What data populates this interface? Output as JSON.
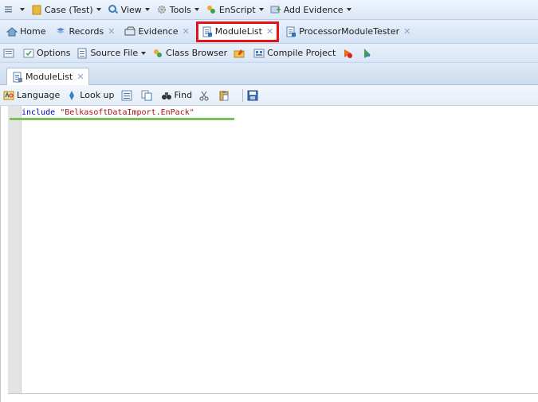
{
  "menu_bar": {
    "items": [
      {
        "label": "Case (Test)",
        "icon": "case-folder-icon"
      },
      {
        "label": "View",
        "icon": "view-icon"
      },
      {
        "label": "Tools",
        "icon": "tools-gear-icon"
      },
      {
        "label": "EnScript",
        "icon": "enscript-icon"
      },
      {
        "label": "Add Evidence",
        "icon": "add-evidence-icon"
      }
    ]
  },
  "tabs": [
    {
      "label": "Home",
      "icon": "home-icon"
    },
    {
      "label": "Records",
      "icon": "records-icon"
    },
    {
      "label": "Evidence",
      "icon": "evidence-icon"
    },
    {
      "label": "ModuleList",
      "icon": "script-file-icon",
      "highlighted": true
    },
    {
      "label": "ProcessorModuleTester",
      "icon": "script-file-icon"
    }
  ],
  "toolbar": {
    "options_label": "Options",
    "source_file_label": "Source File",
    "class_browser_label": "Class Browser",
    "compile_project_label": "Compile Project"
  },
  "document_tab": {
    "label": "ModuleList"
  },
  "editor_toolbar": {
    "language_label": "Language",
    "lookup_label": "Look up",
    "find_label": "Find"
  },
  "editor": {
    "keyword": "include",
    "string_literal": "\"BelkasoftDataImport.EnPack\""
  },
  "colors": {
    "highlight_border": "#e0141b",
    "keyword": "#0000b0",
    "string": "#a31515",
    "squiggle": "#7cbf5f"
  }
}
